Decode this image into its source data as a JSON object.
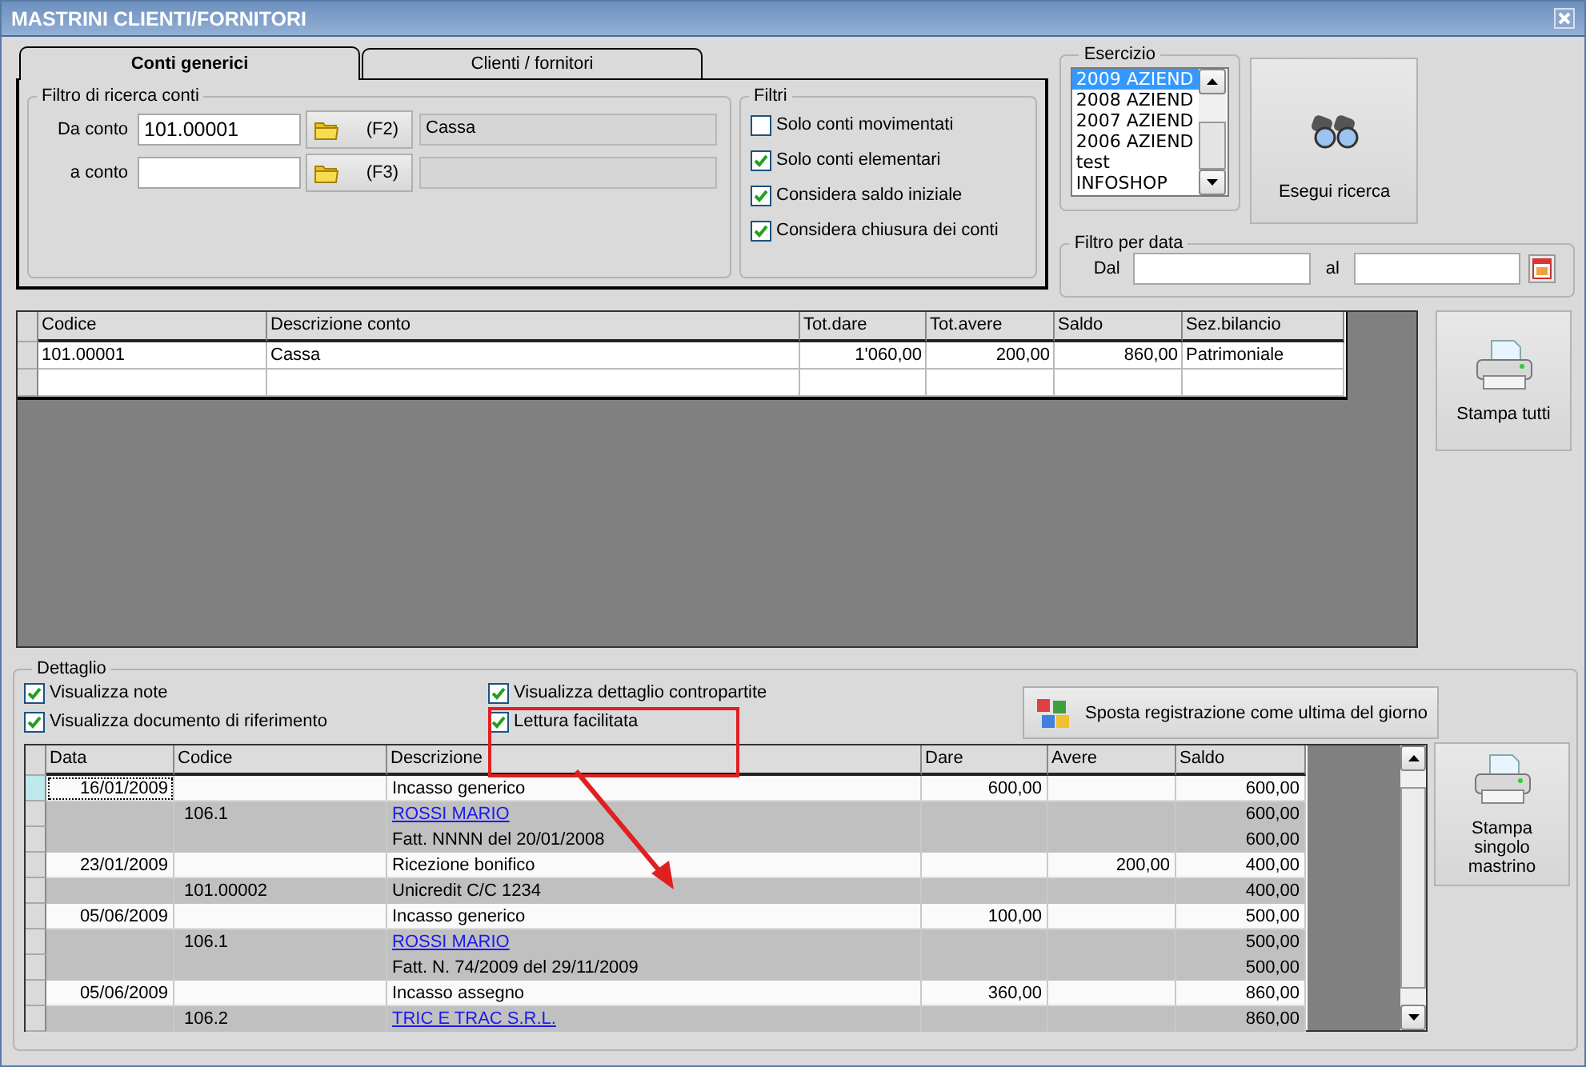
{
  "window": {
    "title": "MASTRINI CLIENTI/FORNITORI"
  },
  "tabs": [
    {
      "label": "Conti generici",
      "selected": true
    },
    {
      "label": "Clienti / fornitori",
      "selected": false
    }
  ],
  "account_filter": {
    "title": "Filtro di ricerca conti",
    "rows": [
      {
        "label": "Da conto",
        "value": "101.00001",
        "key": "(F2)",
        "description": "Cassa"
      },
      {
        "label": "a conto",
        "key": "(F3)"
      }
    ]
  },
  "filters": {
    "title": "Filtri",
    "options": [
      {
        "label": "Solo conti movimentati",
        "checked": false
      },
      {
        "label": "Solo conti elementari",
        "checked": true
      },
      {
        "label": "Considera saldo iniziale",
        "checked": true
      },
      {
        "label": "Considera chiusura dei conti",
        "checked": true
      }
    ]
  },
  "fiscal_year": {
    "title": "Esercizio",
    "items": [
      {
        "label": "2009 AZIEND",
        "selected": true
      },
      {
        "label": "2008 AZIEND",
        "selected": false
      },
      {
        "label": "2007 AZIEND",
        "selected": false
      },
      {
        "label": "2006 AZIEND",
        "selected": false
      },
      {
        "label": "test",
        "selected": false
      },
      {
        "label": "INFOSHOP",
        "selected": false
      }
    ]
  },
  "search_button": {
    "label": "Esegui ricerca"
  },
  "date_filter": {
    "title": "Filtro per data",
    "from_label": "Dal",
    "to_label": "al"
  },
  "accounts_table": {
    "columns": [
      "Codice",
      "Descrizione conto",
      "Tot.dare",
      "Tot.avere",
      "Saldo",
      "Sez.bilancio"
    ],
    "rows": [
      {
        "cells": [
          "101.00001",
          "Cassa",
          "1'060,00",
          "200,00",
          "860,00",
          "Patrimoniale"
        ]
      }
    ]
  },
  "print_all_button": {
    "label": "Stampa tutti"
  },
  "detail": {
    "title": "Dettaglio",
    "options": [
      {
        "label": "Visualizza note",
        "checked": true
      },
      {
        "label": "Visualizza dettaglio contropartite",
        "checked": true
      },
      {
        "label": "Visualizza documento di riferimento",
        "checked": true
      },
      {
        "label": "Lettura facilitata",
        "checked": true
      }
    ],
    "move_button": {
      "label": "Sposta registrazione come ultima del giorno"
    },
    "table": {
      "columns": [
        "Data",
        "Codice",
        "Descrizione",
        "Dare",
        "Avere",
        "Saldo"
      ],
      "rows": [
        {
          "kind": "movement",
          "selected": true,
          "date": "16/01/2009",
          "description": "Incasso generico",
          "debit": "600,00",
          "balance": "600,00"
        },
        {
          "kind": "account",
          "selected": false,
          "code": "106.1",
          "description": "ROSSI MARIO",
          "balance": "600,00"
        },
        {
          "kind": "detail",
          "selected": false,
          "description": "Fatt. NNNN del 20/01/2008",
          "balance": "600,00"
        },
        {
          "kind": "movement",
          "selected": false,
          "date": "23/01/2009",
          "description": "Ricezione bonifico",
          "credit": "200,00",
          "balance": "400,00"
        },
        {
          "kind": "detail",
          "selected": false,
          "code": "101.00002",
          "description": "Unicredit C/C 1234",
          "balance": "400,00"
        },
        {
          "kind": "movement",
          "selected": false,
          "date": "05/06/2009",
          "description": "Incasso generico",
          "debit": "100,00",
          "balance": "500,00"
        },
        {
          "kind": "account",
          "selected": false,
          "code": "106.1",
          "description": "ROSSI MARIO",
          "balance": "500,00"
        },
        {
          "kind": "detail",
          "selected": false,
          "description": "Fatt. N. 74/2009 del 29/11/2009",
          "balance": "500,00"
        },
        {
          "kind": "movement",
          "selected": false,
          "date": "05/06/2009",
          "description": "Incasso assegno",
          "debit": "360,00",
          "balance": "860,00"
        },
        {
          "kind": "account",
          "selected": false,
          "code": "106.2",
          "description": "TRIC E TRAC S.R.L.",
          "balance": "860,00"
        }
      ]
    },
    "print_button": {
      "label": "Stampa singolo mastrino"
    }
  }
}
